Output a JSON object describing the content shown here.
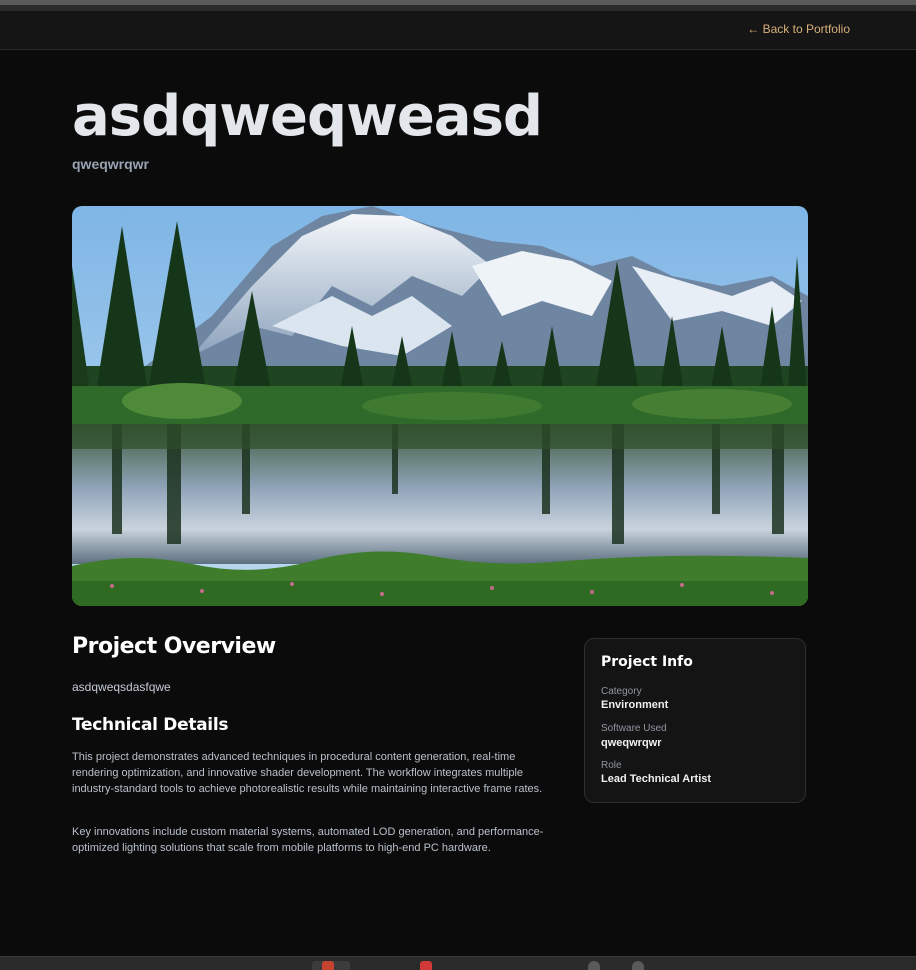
{
  "header": {
    "back_link": "← Back to Portfolio"
  },
  "project": {
    "title": "asdqweqweasd",
    "subtitle": "qweqwrqwr"
  },
  "hero_image": {
    "description_icon": "mountain-lake-landscape"
  },
  "overview": {
    "heading": "Project Overview",
    "text": "asdqweqsdasfqwe"
  },
  "technical": {
    "heading": "Technical Details",
    "paragraph1": "This project demonstrates advanced techniques in procedural content generation, real-time rendering optimization, and innovative shader development. The workflow integrates multiple industry-standard tools to achieve photorealistic results while maintaining interactive frame rates.",
    "paragraph2": "Key innovations include custom material systems, automated LOD generation, and performance-optimized lighting solutions that scale from mobile platforms to high-end PC hardware."
  },
  "info": {
    "title": "Project Info",
    "items": [
      {
        "label": "Category",
        "value": "Environment"
      },
      {
        "label": "Software Used",
        "value": "qweqwrqwr"
      },
      {
        "label": "Role",
        "value": "Lead Technical Artist"
      }
    ]
  },
  "colors": {
    "background": "#0b0b0b",
    "accent_link": "#d8b07a",
    "card_bg": "#141414"
  }
}
